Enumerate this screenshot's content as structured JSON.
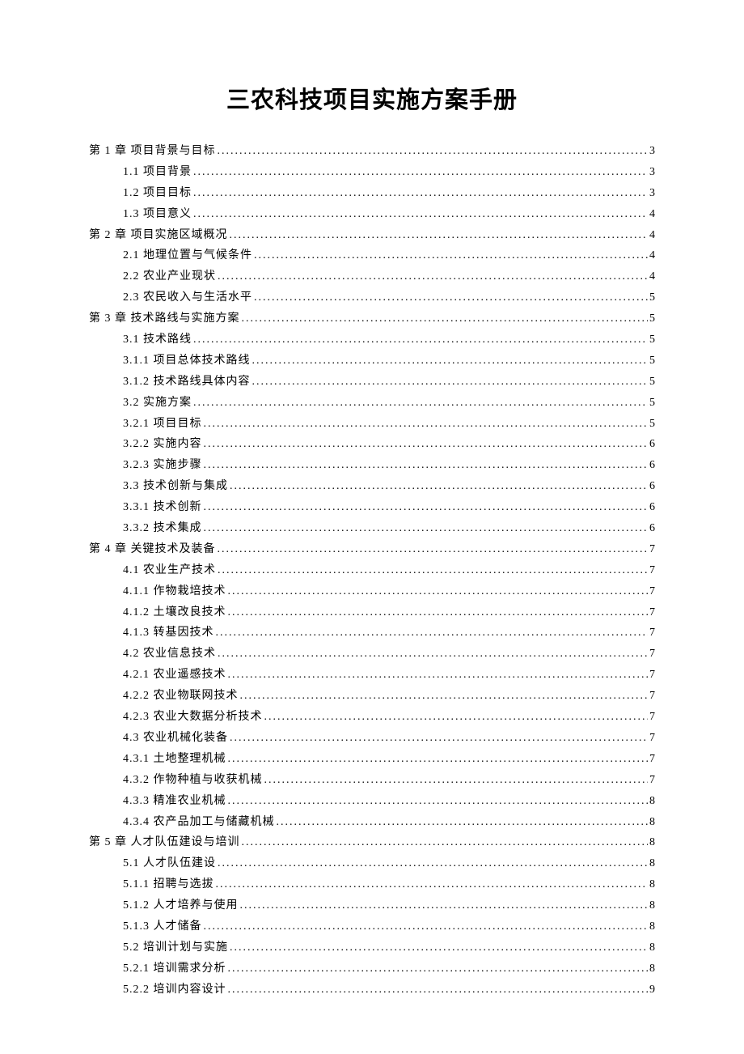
{
  "title": "三农科技项目实施方案手册",
  "toc": [
    {
      "level": 0,
      "label": "第 1 章 项目背景与目标",
      "page": "3"
    },
    {
      "level": 1,
      "label": "1.1 项目背景",
      "page": "3"
    },
    {
      "level": 1,
      "label": "1.2 项目目标",
      "page": "3"
    },
    {
      "level": 1,
      "label": "1.3 项目意义",
      "page": "4"
    },
    {
      "level": 0,
      "label": "第 2 章 项目实施区域概况",
      "page": "4"
    },
    {
      "level": 1,
      "label": "2.1 地理位置与气候条件",
      "page": "4"
    },
    {
      "level": 1,
      "label": "2.2 农业产业现状",
      "page": "4"
    },
    {
      "level": 1,
      "label": "2.3 农民收入与生活水平",
      "page": "5"
    },
    {
      "level": 0,
      "label": "第 3 章 技术路线与实施方案",
      "page": "5"
    },
    {
      "level": 1,
      "label": "3.1 技术路线",
      "page": "5"
    },
    {
      "level": 1,
      "label": "3.1.1 项目总体技术路线",
      "page": "5"
    },
    {
      "level": 1,
      "label": "3.1.2 技术路线具体内容",
      "page": "5"
    },
    {
      "level": 1,
      "label": "3.2 实施方案",
      "page": "5"
    },
    {
      "level": 1,
      "label": "3.2.1 项目目标",
      "page": "5"
    },
    {
      "level": 1,
      "label": "3.2.2 实施内容",
      "page": "6"
    },
    {
      "level": 1,
      "label": "3.2.3 实施步骤",
      "page": "6"
    },
    {
      "level": 1,
      "label": "3.3 技术创新与集成",
      "page": "6"
    },
    {
      "level": 1,
      "label": "3.3.1 技术创新",
      "page": "6"
    },
    {
      "level": 1,
      "label": "3.3.2 技术集成",
      "page": "6"
    },
    {
      "level": 0,
      "label": "第 4 章 关键技术及装备",
      "page": "7"
    },
    {
      "level": 1,
      "label": "4.1 农业生产技术",
      "page": "7"
    },
    {
      "level": 1,
      "label": "4.1.1 作物栽培技术",
      "page": "7"
    },
    {
      "level": 1,
      "label": "4.1.2 土壤改良技术",
      "page": "7"
    },
    {
      "level": 1,
      "label": "4.1.3 转基因技术",
      "page": "7"
    },
    {
      "level": 1,
      "label": "4.2 农业信息技术",
      "page": "7"
    },
    {
      "level": 1,
      "label": "4.2.1 农业遥感技术",
      "page": "7"
    },
    {
      "level": 1,
      "label": "4.2.2 农业物联网技术",
      "page": "7"
    },
    {
      "level": 1,
      "label": "4.2.3 农业大数据分析技术",
      "page": "7"
    },
    {
      "level": 1,
      "label": "4.3 农业机械化装备",
      "page": "7"
    },
    {
      "level": 1,
      "label": "4.3.1 土地整理机械",
      "page": "7"
    },
    {
      "level": 1,
      "label": "4.3.2 作物种植与收获机械",
      "page": "7"
    },
    {
      "level": 1,
      "label": "4.3.3 精准农业机械",
      "page": "8"
    },
    {
      "level": 1,
      "label": "4.3.4 农产品加工与储藏机械",
      "page": "8"
    },
    {
      "level": 0,
      "label": "第 5 章 人才队伍建设与培训",
      "page": "8"
    },
    {
      "level": 1,
      "label": "5.1 人才队伍建设",
      "page": "8"
    },
    {
      "level": 1,
      "label": "5.1.1 招聘与选拔",
      "page": "8"
    },
    {
      "level": 1,
      "label": "5.1.2 人才培养与使用",
      "page": "8"
    },
    {
      "level": 1,
      "label": "5.1.3 人才储备",
      "page": "8"
    },
    {
      "level": 1,
      "label": "5.2 培训计划与实施",
      "page": "8"
    },
    {
      "level": 1,
      "label": "5.2.1 培训需求分析",
      "page": "8"
    },
    {
      "level": 1,
      "label": "5.2.2 培训内容设计",
      "page": "9"
    }
  ]
}
